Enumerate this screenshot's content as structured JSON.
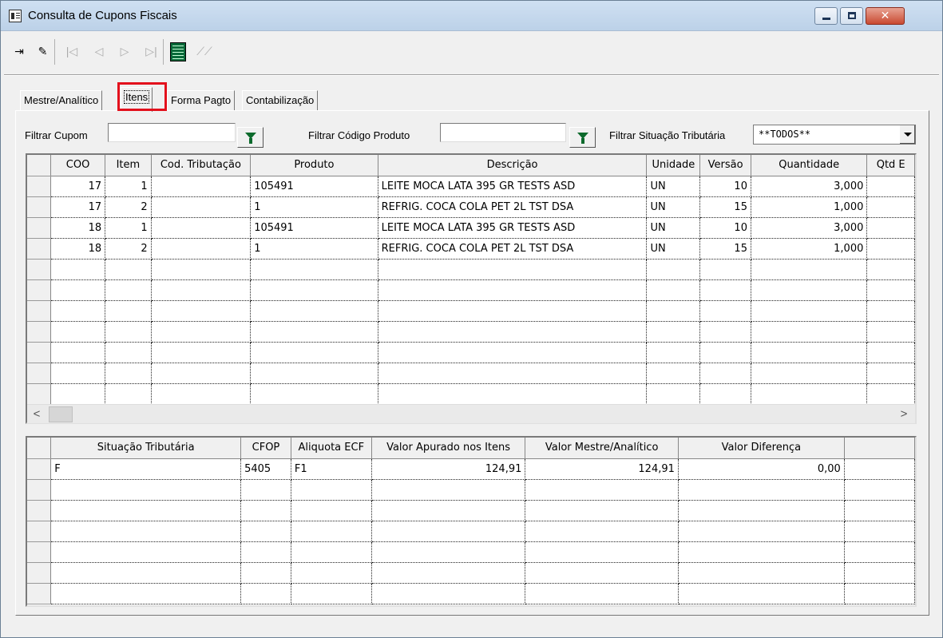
{
  "window": {
    "title": "Consulta de Cupons Fiscais",
    "controls": {
      "minimize": "minimize",
      "maximize": "maximize",
      "close": "✕"
    }
  },
  "toolbar": {
    "buttons": [
      {
        "name": "exit-icon",
        "glyph": "⇥",
        "enabled": true
      },
      {
        "name": "eraser-icon",
        "glyph": "✎",
        "enabled": true
      },
      {
        "name": "first-record-icon",
        "glyph": "|◁",
        "enabled": false
      },
      {
        "name": "prior-record-icon",
        "glyph": "◁",
        "enabled": false
      },
      {
        "name": "next-record-icon",
        "glyph": "▷",
        "enabled": false
      },
      {
        "name": "last-record-icon",
        "glyph": "▷|",
        "enabled": false
      },
      {
        "name": "grid-report-icon",
        "glyph": "",
        "enabled": true
      },
      {
        "name": "disabled-tool-icon",
        "glyph": "⟋⟋",
        "enabled": false
      }
    ]
  },
  "tabs": [
    "Mestre/Analítico",
    "Itens",
    "Forma Pagto",
    "Contabilização"
  ],
  "filters": {
    "cupom_label": "Filtrar Cupom",
    "cupom_value": "",
    "produto_label": "Filtrar Código Produto",
    "produto_value": "",
    "situacao_label": "Filtrar Situação Tributária",
    "situacao_value": "**TODOS**"
  },
  "items_grid": {
    "headers": [
      "COO",
      "Item",
      "Cod. Tributação",
      "Produto",
      "Descrição",
      "Unidade",
      "Versão",
      "Quantidade",
      "Qtd E"
    ],
    "rows": [
      [
        "17",
        "1",
        "",
        "105491",
        "LEITE MOCA LATA 395 GR TESTS ASD",
        "UN",
        "10",
        "3,000",
        ""
      ],
      [
        "17",
        "2",
        "",
        "1",
        "REFRIG. COCA COLA PET 2L TST DSA",
        "UN",
        "15",
        "1,000",
        ""
      ],
      [
        "18",
        "1",
        "",
        "105491",
        "LEITE MOCA LATA 395 GR TESTS ASD",
        "UN",
        "10",
        "3,000",
        ""
      ],
      [
        "18",
        "2",
        "",
        "1",
        "REFRIG. COCA COLA PET 2L TST DSA",
        "UN",
        "15",
        "1,000",
        ""
      ]
    ],
    "empty_rows": 7,
    "scroll_left": "<",
    "scroll_right": ">"
  },
  "summary_grid": {
    "headers": [
      "Situação Tributária",
      "CFOP",
      "Aliquota ECF",
      "Valor Apurado nos Itens",
      "Valor Mestre/Analítico",
      "Valor Diferença",
      ""
    ],
    "rows": [
      [
        "F",
        "5405",
        "F1",
        "124,91",
        "124,91",
        "0,00",
        ""
      ]
    ],
    "empty_rows": 6
  }
}
